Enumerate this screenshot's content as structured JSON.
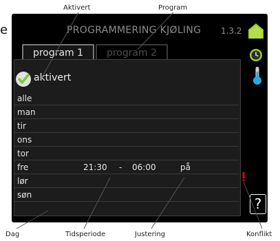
{
  "callouts": {
    "aktivert": "Aktivert",
    "program": "Program",
    "dag": "Dag",
    "tidsperiode": "Tidsperiode",
    "justering": "Justering",
    "konflikt": "Konflikt"
  },
  "edge_text": "e",
  "header": {
    "title": "PROGRAMMERING KJØLING",
    "code": "1.3.2"
  },
  "tabs": [
    {
      "label": "program 1",
      "active": true
    },
    {
      "label": "program 2",
      "active": false
    }
  ],
  "activated": {
    "label": "aktivert",
    "checked": true
  },
  "days": [
    {
      "name": "alle",
      "start": "",
      "dash": "",
      "end": "",
      "adjust": ""
    },
    {
      "name": "man",
      "start": "",
      "dash": "",
      "end": "",
      "adjust": ""
    },
    {
      "name": "tir",
      "start": "",
      "dash": "",
      "end": "",
      "adjust": ""
    },
    {
      "name": "ons",
      "start": "",
      "dash": "",
      "end": "",
      "adjust": ""
    },
    {
      "name": "tor",
      "start": "",
      "dash": "",
      "end": "",
      "adjust": ""
    },
    {
      "name": "fre",
      "start": "21:30",
      "dash": "-",
      "end": "06:00",
      "adjust": "på"
    },
    {
      "name": "lør",
      "start": "",
      "dash": "",
      "end": "",
      "adjust": ""
    },
    {
      "name": "søn",
      "start": "",
      "dash": "",
      "end": "",
      "adjust": ""
    }
  ],
  "help_label": "?",
  "colors": {
    "conflict": "#e0001a",
    "check": "#7fc241",
    "menu_icon": "#9dc83a",
    "thermo": "#29a8e0"
  },
  "icons": [
    "menu-home-icon",
    "clock-icon",
    "thermometer-icon",
    "help-icon"
  ]
}
